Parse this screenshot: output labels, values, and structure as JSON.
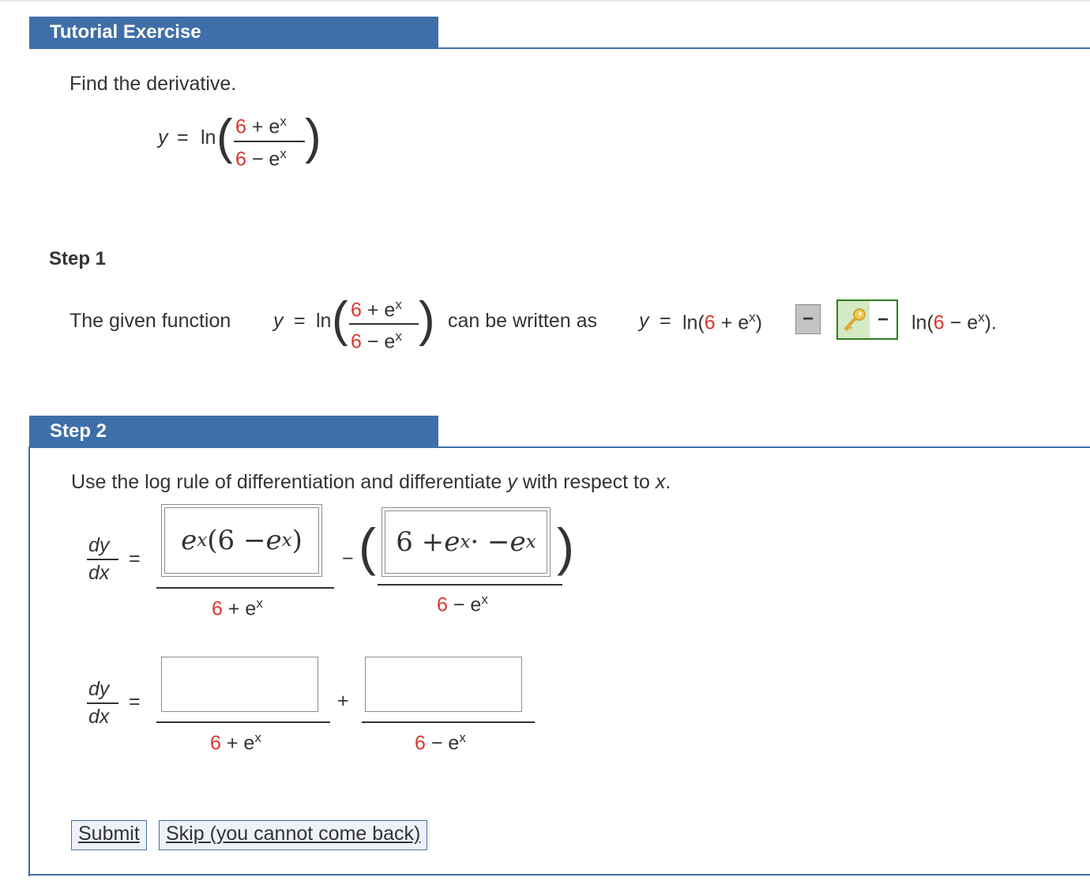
{
  "header": {
    "title": "Tutorial Exercise"
  },
  "problem": {
    "instruction": "Find the derivative.",
    "lhs": "y",
    "eq": "=",
    "ln": "ln",
    "num_const": "6",
    "num_op": "+",
    "num_exp": "e",
    "num_sup": "x",
    "den_const": "6",
    "den_op": "−",
    "den_exp": "e",
    "den_sup": "x"
  },
  "step1": {
    "title": "Step 1",
    "text_before": "The given function",
    "lhs": "y",
    "eq": "=",
    "ln": "ln",
    "frac_num_const": "6",
    "frac_num_rest": "+ e",
    "frac_num_sup": "x",
    "frac_den_const": "6",
    "frac_den_rest": "− e",
    "frac_den_sup": "x",
    "text_middle": "can be written as",
    "rewrite_lhs": "y",
    "rewrite_eq": "=",
    "rewrite_ln_open": "ln(",
    "rewrite_const": "6",
    "rewrite_rest": "+ e",
    "rewrite_sup": "x",
    "rewrite_close": ")",
    "selected_operator": "−",
    "operator_answer": "−",
    "tail_open": "ln(",
    "tail_const": "6",
    "tail_rest": "− e",
    "tail_sup": "x",
    "tail_close": ")."
  },
  "step2": {
    "title": "Step 2",
    "instruction_a": "Use the log rule of differentiation and differentiate",
    "instruction_var": "y",
    "instruction_b": "with respect to",
    "instruction_x": "x",
    "instruction_end": ".",
    "dy": "dy",
    "dx": "dx",
    "eq": "=",
    "row1": {
      "answer1": {
        "e": "e",
        "sup": "x",
        "open": "(6 − ",
        "e2": "e",
        "sup2": "x",
        "close": ")"
      },
      "operator": "−",
      "answer2": {
        "text": "6 + ",
        "e": "e",
        "sup": "x",
        "dot": " · −",
        "e2": "e",
        "sup2": "x"
      },
      "den1_const": "6",
      "den1_rest": "+ e",
      "den1_sup": "x",
      "den2_const": "6",
      "den2_rest": "− e",
      "den2_sup": "x"
    },
    "row2": {
      "input1_value": "",
      "operator": "+",
      "input2_value": "",
      "den1_const": "6",
      "den1_rest": "+ e",
      "den1_sup": "x",
      "den2_const": "6",
      "den2_rest": "− e",
      "den2_sup": "x"
    }
  },
  "buttons": {
    "submit": "Submit",
    "skip": "Skip (you cannot come back)"
  },
  "colors": {
    "header_blue": "#3f6fa8",
    "number_red": "#d8362b",
    "answer_green": "#2e7d1e",
    "key_gold": "#e8b830"
  }
}
